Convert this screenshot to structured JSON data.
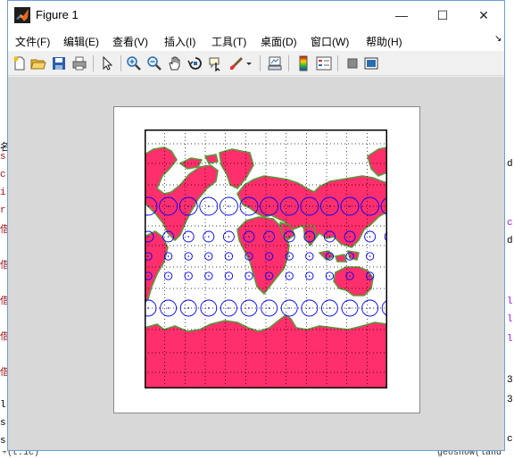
{
  "window": {
    "title": "Figure 1",
    "minimize_glyph": "—",
    "maximize_glyph": "☐",
    "close_glyph": "✕"
  },
  "menu": {
    "items": [
      "文件(F)",
      "编辑(E)",
      "查看(V)",
      "插入(I)",
      "工具(T)",
      "桌面(D)",
      "窗口(W)",
      "帮助(H)"
    ],
    "overflow_glyph": "↘"
  },
  "toolbar": {
    "icons": [
      "new-figure-icon",
      "open-file-icon",
      "save-icon",
      "print-icon",
      "pointer-icon",
      "zoom-in-icon",
      "zoom-out-icon",
      "pan-icon",
      "rotate-3d-icon",
      "data-cursor-icon",
      "brush-icon",
      "link-plot-icon",
      "colorbar-icon",
      "legend-icon",
      "hide-plot-tools-icon",
      "show-plot-tools-icon"
    ]
  },
  "map": {
    "projection": "mercator",
    "land_color": "#ff2e6c",
    "coast_color": "#5a9a3a",
    "indicatrix_color": "#0000ff",
    "grid_color": "#000000"
  },
  "background": {
    "left_chars": [
      "名",
      "s",
      "c",
      "i",
      "r",
      "借",
      "借",
      "借",
      "借",
      "借",
      "l",
      "s",
      "s"
    ],
    "right_chars": [
      "d",
      "c",
      "d",
      "l",
      "l",
      "l",
      "3",
      "3",
      "c"
    ],
    "bottom_left": "+(t.1c)",
    "bottom_right": "geoshow(land"
  }
}
